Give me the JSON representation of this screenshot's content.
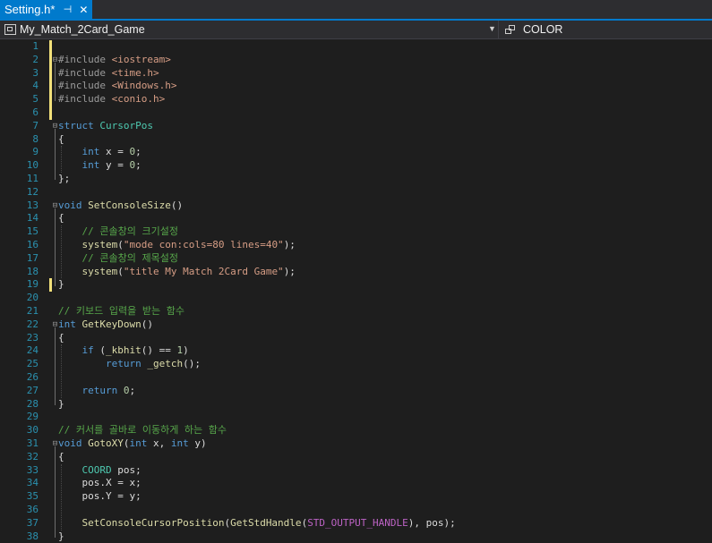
{
  "tab": {
    "title": "Setting.h*",
    "pin_glyph": "⊣",
    "close_glyph": "✕"
  },
  "nav": {
    "project": "My_Match_2Card_Game",
    "scope": "COLOR"
  },
  "colors": {
    "accent": "#007acc",
    "background": "#1e1e1e",
    "line_number": "#2b91af",
    "modified_marker": "#f2e07a"
  },
  "lines": [
    {
      "n": "1",
      "mark": "mod",
      "fold": "",
      "tokens": []
    },
    {
      "n": "2",
      "mark": "mod",
      "fold": "⊟",
      "tokens": [
        {
          "t": "#include",
          "c": "pp"
        },
        {
          "t": " <iostream>",
          "c": "st"
        }
      ]
    },
    {
      "n": "3",
      "mark": "mod",
      "fold": "",
      "tokens": [
        {
          "t": "#include",
          "c": "pp"
        },
        {
          "t": " <time.h>",
          "c": "st"
        }
      ]
    },
    {
      "n": "4",
      "mark": "mod",
      "fold": "",
      "tokens": [
        {
          "t": "#include",
          "c": "pp"
        },
        {
          "t": " <Windows.h>",
          "c": "st"
        }
      ]
    },
    {
      "n": "5",
      "mark": "mod",
      "fold": "",
      "tokens": [
        {
          "t": "#include",
          "c": "pp"
        },
        {
          "t": " <conio.h>",
          "c": "st"
        }
      ]
    },
    {
      "n": "6",
      "mark": "mod",
      "fold": "",
      "tokens": []
    },
    {
      "n": "7",
      "mark": "",
      "fold": "⊟",
      "tokens": [
        {
          "t": "struct",
          "c": "kw"
        },
        {
          "t": " ",
          "c": "plain"
        },
        {
          "t": "CursorPos",
          "c": "ty"
        }
      ]
    },
    {
      "n": "8",
      "mark": "",
      "fold": "",
      "tokens": [
        {
          "t": "{",
          "c": "plain"
        }
      ]
    },
    {
      "n": "9",
      "mark": "",
      "fold": "",
      "tokens": [
        {
          "t": "    ",
          "c": "plain"
        },
        {
          "t": "int",
          "c": "kw"
        },
        {
          "t": " x = ",
          "c": "plain"
        },
        {
          "t": "0",
          "c": "nu"
        },
        {
          "t": ";",
          "c": "plain"
        }
      ]
    },
    {
      "n": "10",
      "mark": "",
      "fold": "",
      "tokens": [
        {
          "t": "    ",
          "c": "plain"
        },
        {
          "t": "int",
          "c": "kw"
        },
        {
          "t": " y = ",
          "c": "plain"
        },
        {
          "t": "0",
          "c": "nu"
        },
        {
          "t": ";",
          "c": "plain"
        }
      ]
    },
    {
      "n": "11",
      "mark": "",
      "fold": "",
      "tokens": [
        {
          "t": "};",
          "c": "plain"
        }
      ]
    },
    {
      "n": "12",
      "mark": "",
      "fold": "",
      "tokens": []
    },
    {
      "n": "13",
      "mark": "",
      "fold": "⊟",
      "tokens": [
        {
          "t": "void",
          "c": "kw"
        },
        {
          "t": " ",
          "c": "plain"
        },
        {
          "t": "SetConsoleSize",
          "c": "fn"
        },
        {
          "t": "()",
          "c": "plain"
        }
      ]
    },
    {
      "n": "14",
      "mark": "",
      "fold": "",
      "tokens": [
        {
          "t": "{",
          "c": "plain"
        }
      ]
    },
    {
      "n": "15",
      "mark": "",
      "fold": "",
      "tokens": [
        {
          "t": "    ",
          "c": "plain"
        },
        {
          "t": "// 콘솔창의 크기설정",
          "c": "cm"
        }
      ]
    },
    {
      "n": "16",
      "mark": "",
      "fold": "",
      "tokens": [
        {
          "t": "    ",
          "c": "plain"
        },
        {
          "t": "system",
          "c": "fn"
        },
        {
          "t": "(",
          "c": "plain"
        },
        {
          "t": "\"mode con:cols=80 lines=40\"",
          "c": "st"
        },
        {
          "t": ");",
          "c": "plain"
        }
      ]
    },
    {
      "n": "17",
      "mark": "",
      "fold": "",
      "tokens": [
        {
          "t": "    ",
          "c": "plain"
        },
        {
          "t": "// 콘솔창의 제목설정",
          "c": "cm"
        }
      ]
    },
    {
      "n": "18",
      "mark": "",
      "fold": "",
      "tokens": [
        {
          "t": "    ",
          "c": "plain"
        },
        {
          "t": "system",
          "c": "fn"
        },
        {
          "t": "(",
          "c": "plain"
        },
        {
          "t": "\"title My Match 2Card Game\"",
          "c": "st"
        },
        {
          "t": ");",
          "c": "plain"
        }
      ]
    },
    {
      "n": "19",
      "mark": "mod",
      "fold": "",
      "tokens": [
        {
          "t": "}",
          "c": "plain"
        }
      ]
    },
    {
      "n": "20",
      "mark": "",
      "fold": "",
      "tokens": []
    },
    {
      "n": "21",
      "mark": "",
      "fold": "",
      "tokens": [
        {
          "t": "// 키보드 입력을 받는 함수",
          "c": "cm"
        }
      ]
    },
    {
      "n": "22",
      "mark": "",
      "fold": "⊟",
      "tokens": [
        {
          "t": "int",
          "c": "kw"
        },
        {
          "t": " ",
          "c": "plain"
        },
        {
          "t": "GetKeyDown",
          "c": "fn"
        },
        {
          "t": "()",
          "c": "plain"
        }
      ]
    },
    {
      "n": "23",
      "mark": "",
      "fold": "",
      "tokens": [
        {
          "t": "{",
          "c": "plain"
        }
      ]
    },
    {
      "n": "24",
      "mark": "",
      "fold": "",
      "tokens": [
        {
          "t": "    ",
          "c": "plain"
        },
        {
          "t": "if",
          "c": "kw"
        },
        {
          "t": " (",
          "c": "plain"
        },
        {
          "t": "_kbhit",
          "c": "fn"
        },
        {
          "t": "() == ",
          "c": "plain"
        },
        {
          "t": "1",
          "c": "nu"
        },
        {
          "t": ")",
          "c": "plain"
        }
      ]
    },
    {
      "n": "25",
      "mark": "",
      "fold": "",
      "tokens": [
        {
          "t": "        ",
          "c": "plain"
        },
        {
          "t": "return",
          "c": "kw"
        },
        {
          "t": " ",
          "c": "plain"
        },
        {
          "t": "_getch",
          "c": "fn"
        },
        {
          "t": "();",
          "c": "plain"
        }
      ]
    },
    {
      "n": "26",
      "mark": "",
      "fold": "",
      "tokens": []
    },
    {
      "n": "27",
      "mark": "",
      "fold": "",
      "tokens": [
        {
          "t": "    ",
          "c": "plain"
        },
        {
          "t": "return",
          "c": "kw"
        },
        {
          "t": " ",
          "c": "plain"
        },
        {
          "t": "0",
          "c": "nu"
        },
        {
          "t": ";",
          "c": "plain"
        }
      ]
    },
    {
      "n": "28",
      "mark": "",
      "fold": "",
      "tokens": [
        {
          "t": "}",
          "c": "plain"
        }
      ]
    },
    {
      "n": "29",
      "mark": "",
      "fold": "",
      "tokens": []
    },
    {
      "n": "30",
      "mark": "",
      "fold": "",
      "tokens": [
        {
          "t": "// 커서를 골바로 이동하게 하는 함수",
          "c": "cm"
        }
      ]
    },
    {
      "n": "31",
      "mark": "",
      "fold": "⊟",
      "tokens": [
        {
          "t": "void",
          "c": "kw"
        },
        {
          "t": " ",
          "c": "plain"
        },
        {
          "t": "GotoXY",
          "c": "fn"
        },
        {
          "t": "(",
          "c": "plain"
        },
        {
          "t": "int",
          "c": "kw"
        },
        {
          "t": " x, ",
          "c": "plain"
        },
        {
          "t": "int",
          "c": "kw"
        },
        {
          "t": " y)",
          "c": "plain"
        }
      ]
    },
    {
      "n": "32",
      "mark": "",
      "fold": "",
      "tokens": [
        {
          "t": "{",
          "c": "plain"
        }
      ]
    },
    {
      "n": "33",
      "mark": "",
      "fold": "",
      "tokens": [
        {
          "t": "    ",
          "c": "plain"
        },
        {
          "t": "COORD",
          "c": "ty"
        },
        {
          "t": " pos;",
          "c": "plain"
        }
      ]
    },
    {
      "n": "34",
      "mark": "",
      "fold": "",
      "tokens": [
        {
          "t": "    ",
          "c": "plain"
        },
        {
          "t": "pos.X = x;",
          "c": "plain"
        }
      ]
    },
    {
      "n": "35",
      "mark": "",
      "fold": "",
      "tokens": [
        {
          "t": "    ",
          "c": "plain"
        },
        {
          "t": "pos.Y = y;",
          "c": "plain"
        }
      ]
    },
    {
      "n": "36",
      "mark": "",
      "fold": "",
      "tokens": []
    },
    {
      "n": "37",
      "mark": "",
      "fold": "",
      "tokens": [
        {
          "t": "    ",
          "c": "plain"
        },
        {
          "t": "SetConsoleCursorPosition",
          "c": "fn"
        },
        {
          "t": "(",
          "c": "plain"
        },
        {
          "t": "GetStdHandle",
          "c": "fn"
        },
        {
          "t": "(",
          "c": "plain"
        },
        {
          "t": "STD_OUTPUT_HANDLE",
          "c": "mc"
        },
        {
          "t": "), pos);",
          "c": "plain"
        }
      ]
    },
    {
      "n": "38",
      "mark": "",
      "fold": "",
      "tokens": [
        {
          "t": "}",
          "c": "plain"
        }
      ]
    }
  ]
}
